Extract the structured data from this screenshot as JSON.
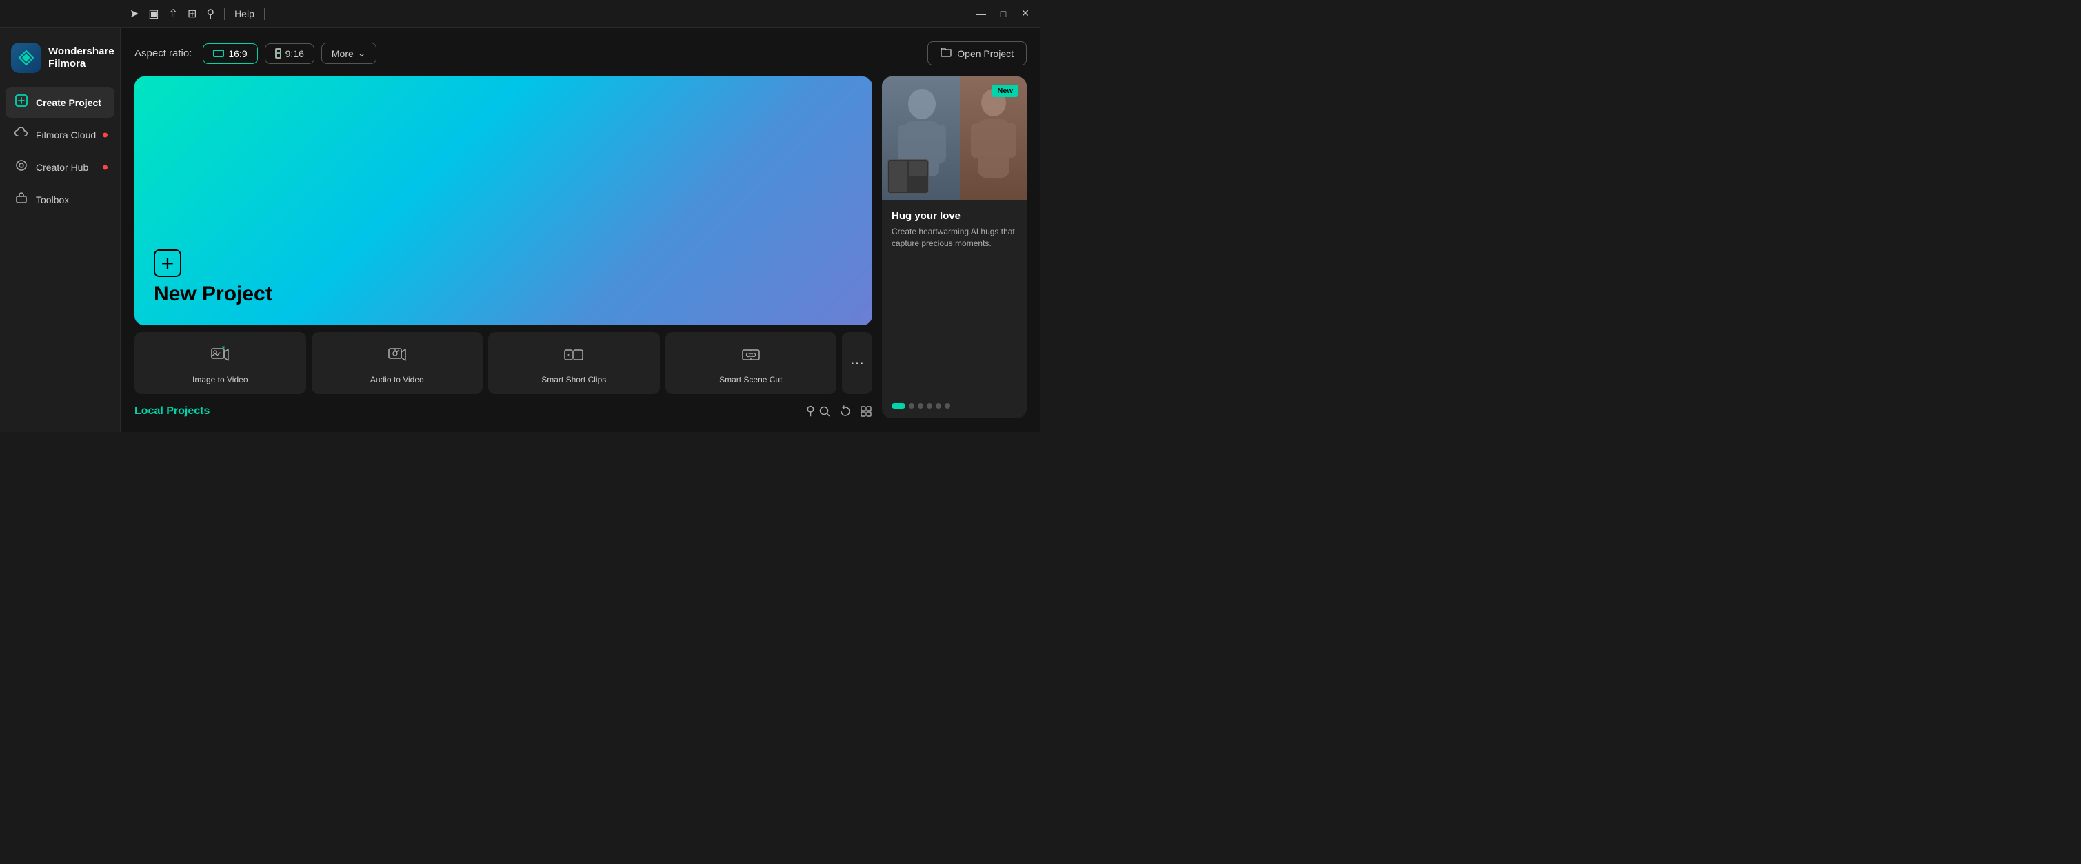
{
  "titleBar": {
    "help": "Help",
    "minimize": "—",
    "maximize": "□",
    "close": "✕",
    "icons": [
      "send-icon",
      "monitor-icon",
      "upload-icon",
      "grid-icon",
      "headset-icon"
    ]
  },
  "sidebar": {
    "logo": {
      "title": "Wondershare\nFilmora"
    },
    "items": [
      {
        "id": "create-project",
        "label": "Create Project",
        "active": true,
        "dot": false
      },
      {
        "id": "filmora-cloud",
        "label": "Filmora Cloud",
        "active": false,
        "dot": true
      },
      {
        "id": "creator-hub",
        "label": "Creator Hub",
        "active": false,
        "dot": true
      },
      {
        "id": "toolbox",
        "label": "Toolbox",
        "active": false,
        "dot": false
      }
    ]
  },
  "aspectRatio": {
    "label": "Aspect ratio:",
    "options": [
      {
        "id": "16-9",
        "value": "16:9",
        "active": true
      },
      {
        "id": "9-16",
        "value": "9:16",
        "active": false
      }
    ],
    "more": "More",
    "openProject": "Open Project"
  },
  "newProject": {
    "title": "New Project"
  },
  "tools": [
    {
      "id": "image-to-video",
      "label": "Image to Video"
    },
    {
      "id": "audio-to-video",
      "label": "Audio to Video"
    },
    {
      "id": "smart-short-clips",
      "label": "Smart Short Clips"
    },
    {
      "id": "smart-scene-cut",
      "label": "Smart Scene Cut"
    }
  ],
  "featureCard": {
    "badge": "New",
    "title": "Hug your love",
    "description": "Create heartwarming AI hugs that capture precious moments.",
    "dots": [
      true,
      false,
      false,
      false,
      false,
      false
    ]
  },
  "localProjects": {
    "title": "Local Projects"
  }
}
